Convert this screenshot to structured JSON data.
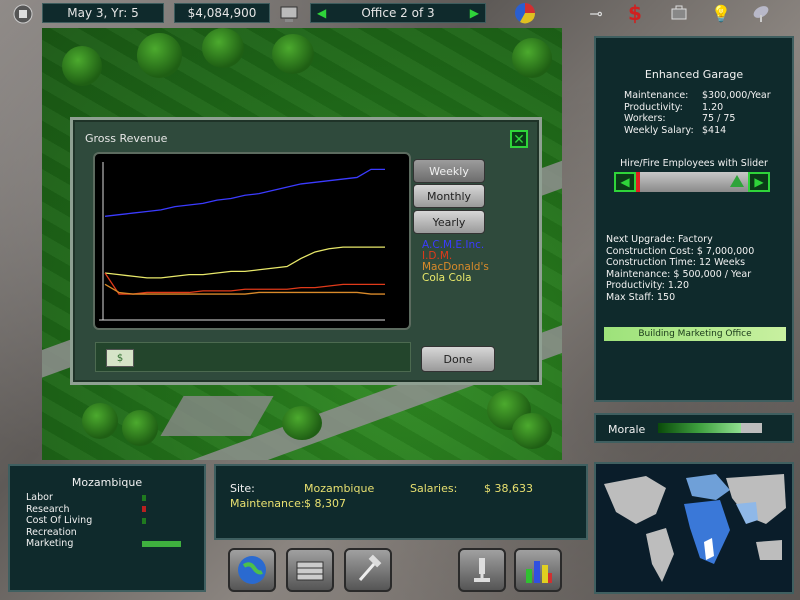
{
  "topbar": {
    "date": "May 3, Yr: 5",
    "money": "$4,084,900",
    "office_label": "Office 2 of 3"
  },
  "dialog": {
    "title": "Gross Revenue",
    "buttons": [
      "Weekly",
      "Monthly",
      "Yearly"
    ],
    "done_label": "Done",
    "companies": [
      {
        "name": "A.C.M.E.Inc.",
        "color": "#3b3bff"
      },
      {
        "name": "I.D.M.",
        "color": "#e03a1a"
      },
      {
        "name": "MacDonald's",
        "color": "#d98a2a"
      },
      {
        "name": "Cola Cola",
        "color": "#e8e86a"
      }
    ]
  },
  "chart_data": {
    "type": "line",
    "title": "Gross Revenue",
    "xlabel": "",
    "ylabel": "",
    "x": [
      0,
      1,
      2,
      3,
      4,
      5,
      6,
      7,
      8,
      9,
      10,
      11,
      12,
      13,
      14,
      15,
      16,
      17,
      18,
      19,
      20
    ],
    "ylim": [
      0,
      100
    ],
    "series": [
      {
        "name": "A.C.M.E.Inc.",
        "color": "#3b3bff",
        "values": [
          64,
          65,
          66,
          67,
          68,
          70,
          71,
          72,
          74,
          75,
          77,
          78,
          80,
          82,
          84,
          85,
          86,
          87,
          88,
          93,
          93
        ]
      },
      {
        "name": "Cola Cola",
        "color": "#e8e86a",
        "values": [
          29,
          28,
          27,
          26,
          26,
          27,
          28,
          28,
          29,
          30,
          30,
          31,
          32,
          33,
          38,
          42,
          44,
          45,
          45,
          45,
          45
        ]
      },
      {
        "name": "I.D.M.",
        "color": "#e03a1a",
        "values": [
          29,
          16,
          16,
          17,
          17,
          17,
          17,
          18,
          18,
          18,
          19,
          19,
          19,
          19,
          20,
          20,
          21,
          22,
          22,
          22,
          22
        ]
      },
      {
        "name": "MacDonald's",
        "color": "#d98a2a",
        "values": [
          22,
          17,
          16,
          16,
          16,
          16,
          16,
          16,
          16,
          16,
          16,
          17,
          17,
          17,
          17,
          17,
          17,
          17,
          17,
          16,
          16
        ]
      }
    ]
  },
  "building": {
    "name": "Enhanced Garage",
    "stats": [
      {
        "label": "Maintenance:",
        "value": "$300,000/Year"
      },
      {
        "label": "Productivity:",
        "value": "1.20"
      },
      {
        "label": "Workers:",
        "value": "75 / 75"
      },
      {
        "label": "Weekly Salary:",
        "value": "$414"
      }
    ],
    "slider_label": "Hire/Fire Employees with Slider",
    "slider_fraction": 0.03,
    "upgrade_lines": [
      "Next Upgrade: Factory",
      "Construction Cost: $ 7,000,000",
      "Construction Time: 12 Weeks",
      "Maintenance: $ 500,000 / Year",
      "Productivity: 1.20",
      "Max Staff: 150"
    ],
    "status_bar": "Building Marketing Office"
  },
  "morale": {
    "label": "Morale",
    "fraction": 0.8
  },
  "country_panel": {
    "name": "Mozambique",
    "items": [
      {
        "label": "Labor",
        "color": "#1f7a1f",
        "fraction": 0.05
      },
      {
        "label": "Research",
        "color": "#b82020",
        "fraction": 0.05
      },
      {
        "label": "Cost Of Living",
        "color": "#1f7a1f",
        "fraction": 0.05
      },
      {
        "label": "Recreation",
        "color": "#1f7a1f",
        "fraction": 0.0
      },
      {
        "label": "Marketing",
        "color": "#3fb03f",
        "fraction": 0.55
      }
    ]
  },
  "info_panel": {
    "site_label": "Site:",
    "site_value": "Mozambique",
    "maintenance_label": "Maintenance:",
    "maintenance_value": "$ 8,307",
    "salaries_label": "Salaries:",
    "salaries_value": "$ 38,633"
  },
  "icons": {
    "top": [
      "calendar-icon",
      "money-icon",
      "computer-icon",
      "prev-arrow-icon",
      "next-arrow-icon",
      "pie-chart-icon",
      "key-icon",
      "dollar-icon",
      "briefcase-icon",
      "lightbulb-icon",
      "satellite-icon"
    ],
    "bottom": [
      "globe-icon",
      "building-icon",
      "hammer-icon",
      "microscope-icon",
      "bar-chart-icon"
    ]
  }
}
